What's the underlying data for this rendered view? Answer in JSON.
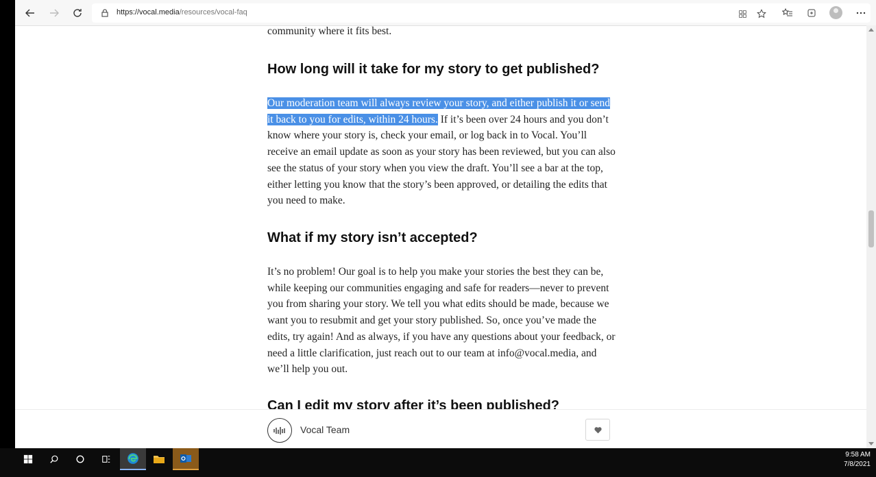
{
  "browser": {
    "url_host": "https://vocal.media",
    "url_path": "/resources/vocal-faq",
    "icons": [
      "back-icon",
      "forward-icon",
      "refresh-icon",
      "lock-icon",
      "app-available-icon",
      "add-favorite-icon",
      "favorites-icon",
      "collections-icon",
      "profile-icon",
      "more-icon"
    ]
  },
  "article": {
    "intro_tail": "community where it fits best.",
    "sections": [
      {
        "heading": "How long will it take for my story to get published?",
        "selected_text": "Our moderation team will always review your story, and either publish it or send it back to you for edits, within 24 hours.",
        "body_rest": " If it’s been over 24 hours and you don’t know where your story is, check your email, or log back in to Vocal. You’ll receive an email update as soon as your story has been reviewed, but you can also see the status of your story when you view the draft. You’ll see a bar at the top, either letting you know that the story’s been approved, or detailing the edits that you need to make."
      },
      {
        "heading": "What if my story isn’t accepted?",
        "body": "It’s no problem! Our goal is to help you make your stories the best they can be, while keeping our communities engaging and safe for readers—never to prevent you from sharing your story. We tell you what edits should be made, because we want you to resubmit and get your story published. So, once you’ve made the edits, try again! And as always, if you have any questions about your feedback, or need a little clarification, just reach out to our team at info@vocal.media, and we’ll help you out."
      },
      {
        "heading": "Can I edit my story after it’s been published?"
      }
    ]
  },
  "footer": {
    "author": "Vocal Team"
  },
  "taskbar": {
    "time": "9:58 AM",
    "date": "7/8/2021"
  }
}
